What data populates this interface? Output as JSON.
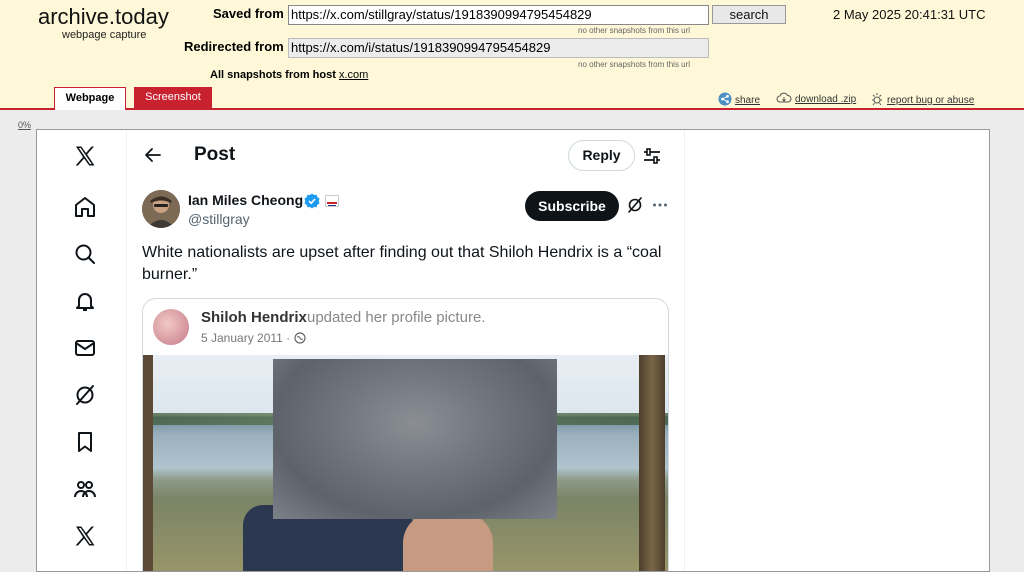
{
  "archive": {
    "logo": "archive.today",
    "logo_sub": "webpage capture",
    "saved_from_label": "Saved from",
    "saved_from_url": "https://x.com/stillgray/status/1918390994795454829",
    "search_label": "search",
    "no_other_snapshots": "no other snapshots from this url",
    "redirected_from_label": "Redirected from",
    "redirected_from_url": "https://x.com/i/status/1918390994795454829",
    "all_snapshots_label": "All snapshots  from host",
    "host": "x.com",
    "datetime": "2 May 2025 20:41:31 UTC",
    "tabs": [
      "Webpage",
      "Screenshot"
    ],
    "tools": {
      "share": "share",
      "download": "download .zip",
      "report": "report bug or abuse"
    },
    "zoom": "0%",
    "accent_color": "#c9222f",
    "header_bg": "#fff8d8"
  },
  "nav_icons": [
    "x-logo-icon",
    "home-icon",
    "explore-icon",
    "notifications-icon",
    "messages-icon",
    "grok-icon",
    "bookmarks-icon",
    "communities-icon",
    "premium-icon"
  ],
  "post": {
    "header_title": "Post",
    "reply_label": "Reply",
    "author_name": "Ian Miles Cheong",
    "author_handle": "@stillgray",
    "subscribe_label": "Subscribe",
    "text": "White nationalists are upset after finding out that Shiloh Hendrix is a “coal burner.”",
    "embedded": {
      "name": "Shiloh Hendrix",
      "action": "updated her profile picture.",
      "date": "5 January 2011 · "
    }
  }
}
